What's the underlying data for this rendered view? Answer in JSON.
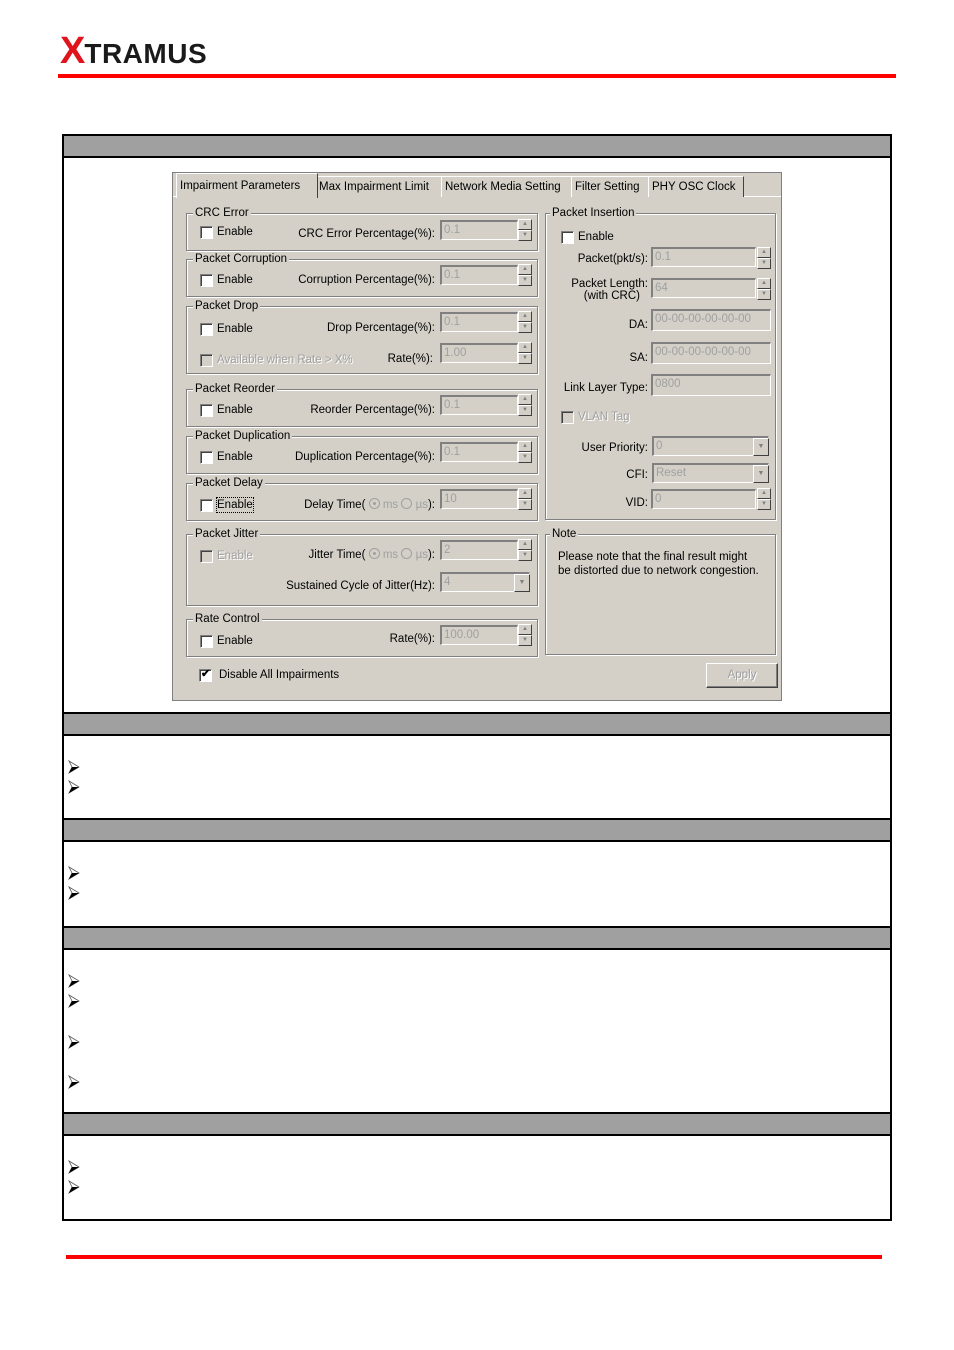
{
  "header": {
    "logo_x": "X",
    "logo_rest": "TRAMUS"
  },
  "colors": {
    "brand_red": "#ff0000",
    "section_bar": "#a0a0a0",
    "dialog_bg": "#d4d0c8"
  },
  "dialog": {
    "tabs": [
      {
        "label": "Impairment Parameters",
        "active": true
      },
      {
        "label": "Max Impairment Limit",
        "active": false
      },
      {
        "label": "Network Media Setting",
        "active": false
      },
      {
        "label": "Filter Setting",
        "active": false
      },
      {
        "label": "PHY OSC Clock",
        "active": false
      }
    ],
    "crc_error": {
      "title": "CRC Error",
      "enable_label": "Enable",
      "enabled": false,
      "field_label": "CRC Error  Percentage(%):",
      "value": "0.1"
    },
    "packet_corruption": {
      "title": "Packet Corruption",
      "enable_label": "Enable",
      "enabled": false,
      "field_label": "Corruption Percentage(%):",
      "value": "0.1"
    },
    "packet_drop": {
      "title": "Packet Drop",
      "enable_label": "Enable",
      "enabled": false,
      "field_label": "Drop Percentage(%):",
      "value": "0.1",
      "available_label": "Available when Rate > X%",
      "rate_label": "Rate(%):",
      "rate_value": "1.00"
    },
    "packet_reorder": {
      "title": "Packet Reorder",
      "enable_label": "Enable",
      "enabled": false,
      "field_label": "Reorder Percentage(%):",
      "value": "0.1"
    },
    "packet_duplication": {
      "title": "Packet Duplication",
      "enable_label": "Enable",
      "enabled": false,
      "field_label": "Duplication Percentage(%):",
      "value": "0.1"
    },
    "packet_delay": {
      "title": "Packet Delay",
      "enable_label": "Enable",
      "enabled": false,
      "field_label_pre": "Delay Time(",
      "unit_ms": "ms",
      "unit_us": "µs",
      "field_label_post": "):",
      "selected_unit": "ms",
      "value": "10"
    },
    "packet_jitter": {
      "title": "Packet Jitter",
      "enable_label": "Enable",
      "enabled": false,
      "field_label_pre": "Jitter Time(",
      "unit_ms": "ms",
      "unit_us": "µs",
      "field_label_post": "):",
      "selected_unit": "ms",
      "value": "2",
      "cycle_label": "Sustained Cycle of Jitter(Hz):",
      "cycle_value": "4"
    },
    "rate_control": {
      "title": "Rate Control",
      "enable_label": "Enable",
      "enabled": false,
      "field_label": "Rate(%):",
      "value": "100.00"
    },
    "disable_all": {
      "label": "Disable All Impairments",
      "checked": true
    },
    "packet_insertion": {
      "title": "Packet Insertion",
      "enable_label": "Enable",
      "enabled": false,
      "packet_label": "Packet(pkt/s):",
      "packet_value": "0.1",
      "length_label_1": "Packet Length:",
      "length_label_2": "(with CRC)",
      "length_value": "64",
      "da_label": "DA:",
      "da_value": "00-00-00-00-00-00",
      "sa_label": "SA:",
      "sa_value": "00-00-00-00-00-00",
      "link_layer_label": "Link Layer Type:",
      "link_layer_value": "0800",
      "vlan_label": "VLAN Tag",
      "vlan_checked": false,
      "user_priority_label": "User Priority:",
      "user_priority_value": "0",
      "cfi_label": "CFI:",
      "cfi_value": "Reset",
      "vid_label": "VID:",
      "vid_value": "0"
    },
    "note": {
      "title": "Note",
      "line1": "Please note that the final result might",
      "line2": "be distorted due to network congestion."
    },
    "apply_label": "Apply"
  },
  "sections": [
    {
      "bullets": 2
    },
    {
      "bullets": 2
    },
    {
      "bullets": 4
    },
    {
      "bullets": 2
    }
  ]
}
